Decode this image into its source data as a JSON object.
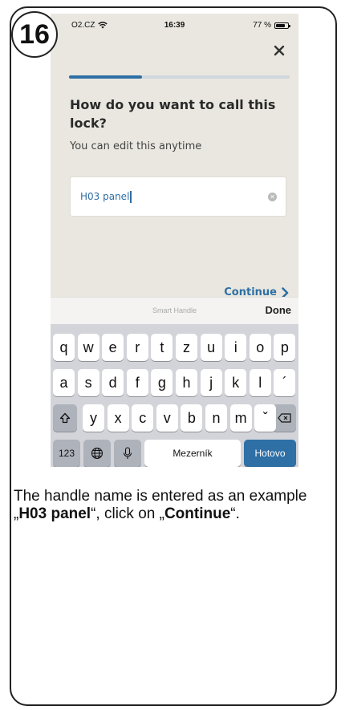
{
  "step": {
    "number": "16"
  },
  "status_bar": {
    "carrier": "O2.CZ",
    "time": "16:39",
    "battery_text": "77 %",
    "battery_level": 0.77
  },
  "progress": {
    "fraction": 0.33
  },
  "screen": {
    "heading": "How do you want to call this lock?",
    "subheading": "You can edit this anytime",
    "input_value": "H03 panel",
    "continue_label": "Continue"
  },
  "keyboard": {
    "accessory_hint": "Smart Handle",
    "done_label": "Done",
    "row1": [
      "q",
      "w",
      "e",
      "r",
      "t",
      "z",
      "u",
      "i",
      "o",
      "p"
    ],
    "row2": [
      "a",
      "s",
      "d",
      "f",
      "g",
      "h",
      "j",
      "k",
      "l",
      "´"
    ],
    "row3": [
      "y",
      "x",
      "c",
      "v",
      "b",
      "n",
      "m",
      "ˇ"
    ],
    "numbers_label": "123",
    "space_label": "Mezerník",
    "return_label": "Hotovo"
  },
  "caption": {
    "part1": "The handle name is entered as an example „",
    "bold1": "H03 panel",
    "part2": "“, click on „",
    "bold2": "Continue",
    "part3": "“."
  }
}
